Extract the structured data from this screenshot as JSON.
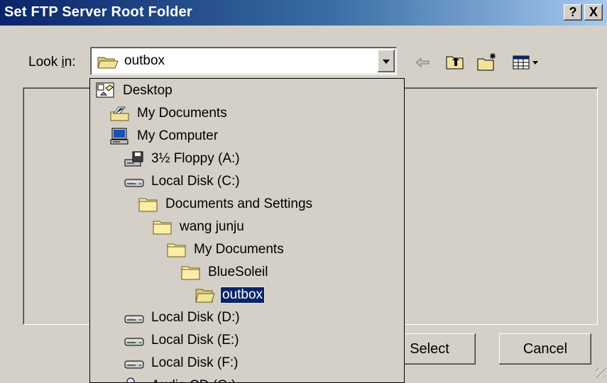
{
  "dialog": {
    "title": "Set FTP Server Root Folder",
    "help_glyph": "?",
    "close_glyph": "X"
  },
  "lookin": {
    "label_prefix": "Look ",
    "label_accel": "i",
    "label_suffix": "n:",
    "value": "outbox"
  },
  "toolbar": {
    "back_icon": "back-arrow-icon",
    "up_icon": "up-folder-icon",
    "newfolder_icon": "new-folder-icon",
    "view_icon": "view-menu-icon"
  },
  "dropdown_items": [
    {
      "label": "Desktop",
      "icon": "desktop-icon",
      "level": 0
    },
    {
      "label": "My Documents",
      "icon": "my-documents-icon",
      "level": 1
    },
    {
      "label": "My Computer",
      "icon": "my-computer-icon",
      "level": 1
    },
    {
      "label": "3½ Floppy (A:)",
      "icon": "floppy-icon",
      "level": 2
    },
    {
      "label": "Local Disk (C:)",
      "icon": "disk-icon",
      "level": 2
    },
    {
      "label": "Documents and Settings",
      "icon": "folder-icon",
      "level": 3
    },
    {
      "label": "wang junju",
      "icon": "folder-icon",
      "level": 4
    },
    {
      "label": "My Documents",
      "icon": "folder-icon",
      "level": 5
    },
    {
      "label": "BlueSoleil",
      "icon": "folder-icon",
      "level": 6
    },
    {
      "label": "outbox",
      "icon": "open-folder-icon",
      "level": 7,
      "selected": true
    },
    {
      "label": "Local Disk (D:)",
      "icon": "disk-icon",
      "level": 2
    },
    {
      "label": "Local Disk (E:)",
      "icon": "disk-icon",
      "level": 2
    },
    {
      "label": "Local Disk (F:)",
      "icon": "disk-icon",
      "level": 2
    },
    {
      "label": "Audio CD (G:)",
      "icon": "cd-icon",
      "level": 2
    }
  ],
  "buttons": {
    "select": "Select",
    "cancel": "Cancel"
  }
}
